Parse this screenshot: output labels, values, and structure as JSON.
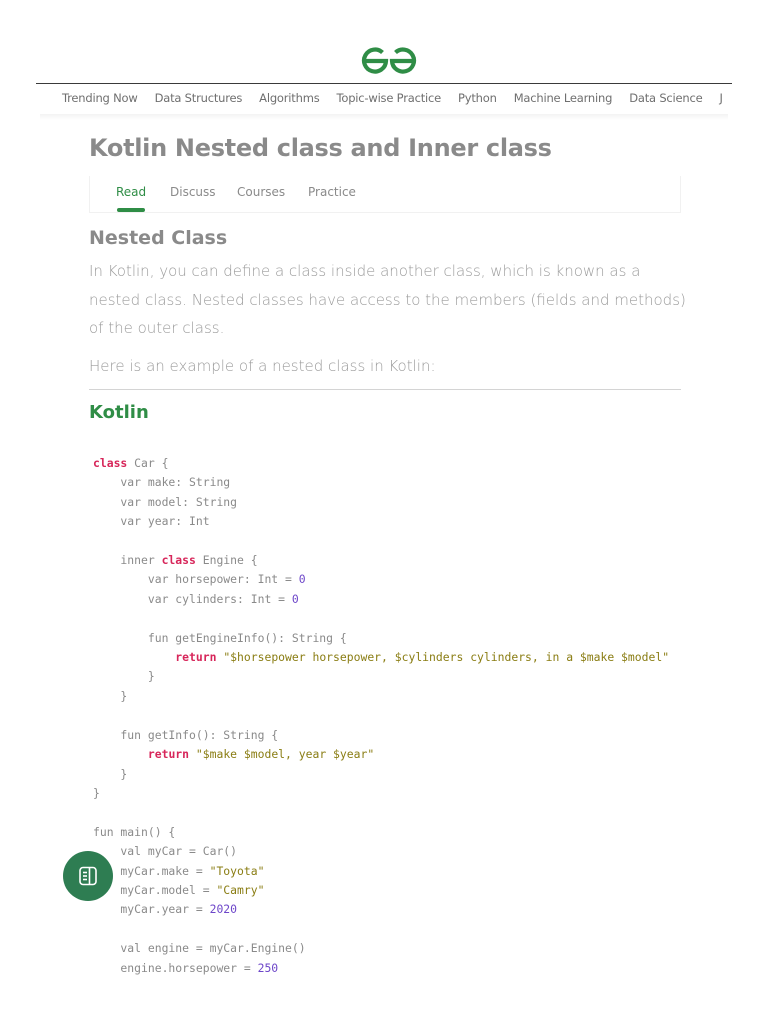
{
  "nav": {
    "items": [
      "Trending Now",
      "Data Structures",
      "Algorithms",
      "Topic-wise Practice",
      "Python",
      "Machine Learning",
      "Data Science",
      "J"
    ]
  },
  "article": {
    "title": "Kotlin Nested class and Inner class",
    "tabs": [
      "Read",
      "Discuss",
      "Courses",
      "Practice"
    ],
    "active_tab": "Read",
    "section_heading": "Nested Class",
    "paragraph1": "In Kotlin, you can define a class inside another class, which is known as a nested class. Nested classes have access to the members (fields and methods) of the outer class.",
    "paragraph2": "Here is an example of a nested class in Kotlin:",
    "code_language": "Kotlin"
  },
  "code_lines": [
    [
      [
        "kw",
        "class"
      ],
      [
        "t",
        " Car {"
      ]
    ],
    [
      [
        "t",
        "    var make: String"
      ]
    ],
    [
      [
        "t",
        "    var model: String"
      ]
    ],
    [
      [
        "t",
        "    var year: Int"
      ]
    ],
    [
      [
        "t",
        ""
      ]
    ],
    [
      [
        "t",
        "    inner "
      ],
      [
        "kw",
        "class"
      ],
      [
        "t",
        " Engine {"
      ]
    ],
    [
      [
        "t",
        "        var horsepower: Int = "
      ],
      [
        "num",
        "0"
      ]
    ],
    [
      [
        "t",
        "        var cylinders: Int = "
      ],
      [
        "num",
        "0"
      ]
    ],
    [
      [
        "t",
        ""
      ]
    ],
    [
      [
        "t",
        "        fun getEngineInfo(): String {"
      ]
    ],
    [
      [
        "t",
        "            "
      ],
      [
        "kw",
        "return"
      ],
      [
        "t",
        " "
      ],
      [
        "str",
        "\"$horsepower horsepower, $cylinders cylinders, in a $make $model\""
      ]
    ],
    [
      [
        "t",
        "        }"
      ]
    ],
    [
      [
        "t",
        "    }"
      ]
    ],
    [
      [
        "t",
        ""
      ]
    ],
    [
      [
        "t",
        "    fun getInfo(): String {"
      ]
    ],
    [
      [
        "t",
        "        "
      ],
      [
        "kw",
        "return"
      ],
      [
        "t",
        " "
      ],
      [
        "str",
        "\"$make $model, year $year\""
      ]
    ],
    [
      [
        "t",
        "    }"
      ]
    ],
    [
      [
        "t",
        "}"
      ]
    ],
    [
      [
        "t",
        ""
      ]
    ],
    [
      [
        "t",
        "fun main() {"
      ]
    ],
    [
      [
        "t",
        "    val myCar = Car()"
      ]
    ],
    [
      [
        "t",
        "    myCar.make = "
      ],
      [
        "str",
        "\"Toyota\""
      ]
    ],
    [
      [
        "t",
        "    myCar.model = "
      ],
      [
        "str",
        "\"Camry\""
      ]
    ],
    [
      [
        "t",
        "    myCar.year = "
      ],
      [
        "num",
        "2020"
      ]
    ],
    [
      [
        "t",
        ""
      ]
    ],
    [
      [
        "t",
        "    val engine = myCar.Engine()"
      ]
    ],
    [
      [
        "t",
        "    engine.horsepower = "
      ],
      [
        "num",
        "250"
      ]
    ]
  ],
  "colors": {
    "brand": "#2f8d46",
    "keyword": "#d7265a",
    "string": "#8a7d13",
    "number": "#6d46c9",
    "fab": "#2e7d52"
  },
  "icons": {
    "logo": "gfg-logo-icon",
    "fab": "article-icon"
  }
}
